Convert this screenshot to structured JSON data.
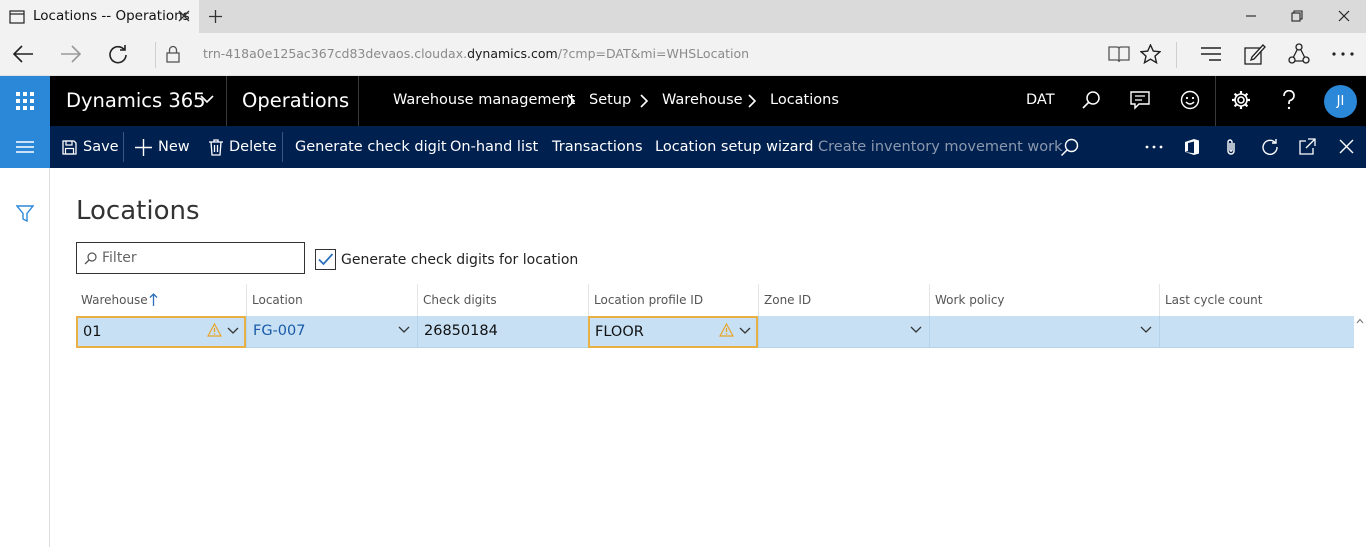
{
  "browser": {
    "tab_title": "Locations -- Operations",
    "url_prefix": "trn-418a0e125ac367cd83devaos.cloudax.",
    "url_host": "dynamics.com",
    "url_suffix": "/?cmp=DAT&mi=WHSLocation"
  },
  "header": {
    "brand": "Dynamics 365",
    "app": "Operations",
    "breadcrumbs": [
      "Warehouse management",
      "Setup",
      "Warehouse",
      "Locations"
    ],
    "company": "DAT",
    "user_initials": "JI"
  },
  "actions": {
    "save": "Save",
    "new": "New",
    "delete": "Delete",
    "generate_check_digit": "Generate check digit",
    "onhand_list": "On-hand list",
    "transactions": "Transactions",
    "location_setup_wizard": "Location setup wizard",
    "create_inventory_movement_work": "Create inventory movement work"
  },
  "page": {
    "title": "Locations",
    "filter_placeholder": "Filter",
    "generate_check_digits_label": "Generate check digits for location",
    "generate_check_digits_checked": true
  },
  "grid": {
    "columns": [
      "Warehouse",
      "Location",
      "Check digits",
      "Location profile ID",
      "Zone ID",
      "Work policy",
      "Last cycle count"
    ],
    "sorted_column": "Warehouse",
    "rows": [
      {
        "warehouse": "01",
        "location": "FG-007",
        "check_digits": "26850184",
        "location_profile_id": "FLOOR",
        "zone_id": "",
        "work_policy": "",
        "last_cycle_count": ""
      }
    ]
  },
  "colors": {
    "accent": "#2b88d8",
    "action_pane": "#002050",
    "selected_row": "#c7e0f4",
    "warning": "#e9b046"
  }
}
